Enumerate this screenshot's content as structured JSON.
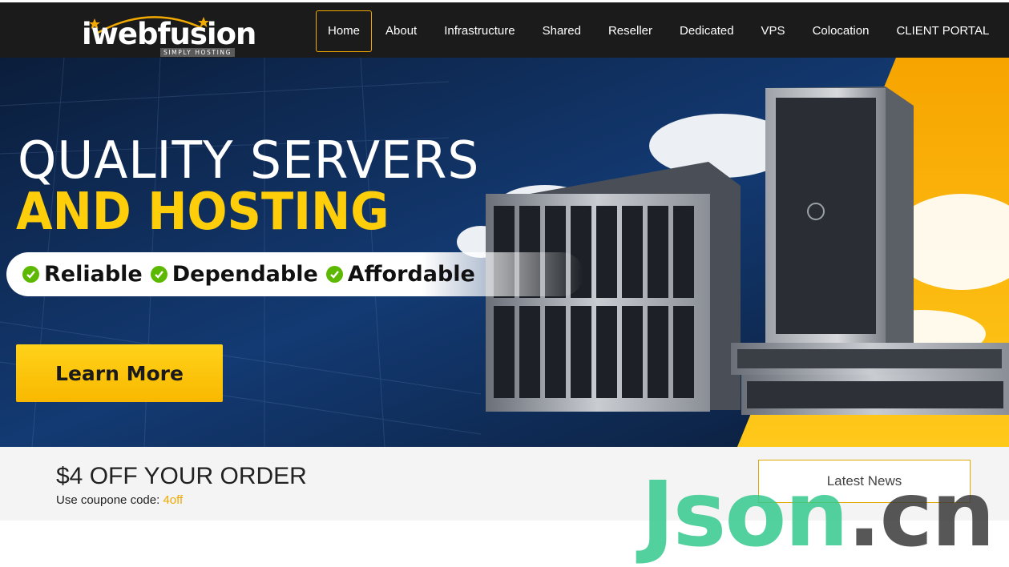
{
  "brand": {
    "logo_text": "iwebfusion",
    "tagline": "SIMPLY HOSTING"
  },
  "nav": {
    "items": [
      {
        "label": "Home",
        "active": true
      },
      {
        "label": "About"
      },
      {
        "label": "Infrastructure"
      },
      {
        "label": "Shared"
      },
      {
        "label": "Reseller"
      },
      {
        "label": "Dedicated"
      },
      {
        "label": "VPS"
      },
      {
        "label": "Colocation"
      },
      {
        "label": "CLIENT PORTAL"
      }
    ]
  },
  "hero": {
    "headline_line1": "QUALITY SERVERS",
    "headline_line2": "AND HOSTING",
    "features": [
      "Reliable",
      "Dependable",
      "Affordable"
    ],
    "cta_label": "Learn More"
  },
  "promo": {
    "title": "$4 OFF YOUR ORDER",
    "subtitle_prefix": "Use coupone code: ",
    "code": "4off",
    "news_button": "Latest News"
  },
  "watermark": {
    "part1": "Json",
    "part2": ".cn"
  },
  "colors": {
    "accent": "#f2a900",
    "headline_yellow": "#ffce0a",
    "check_green": "#5cb800",
    "header_bg": "#1c1b1b"
  }
}
